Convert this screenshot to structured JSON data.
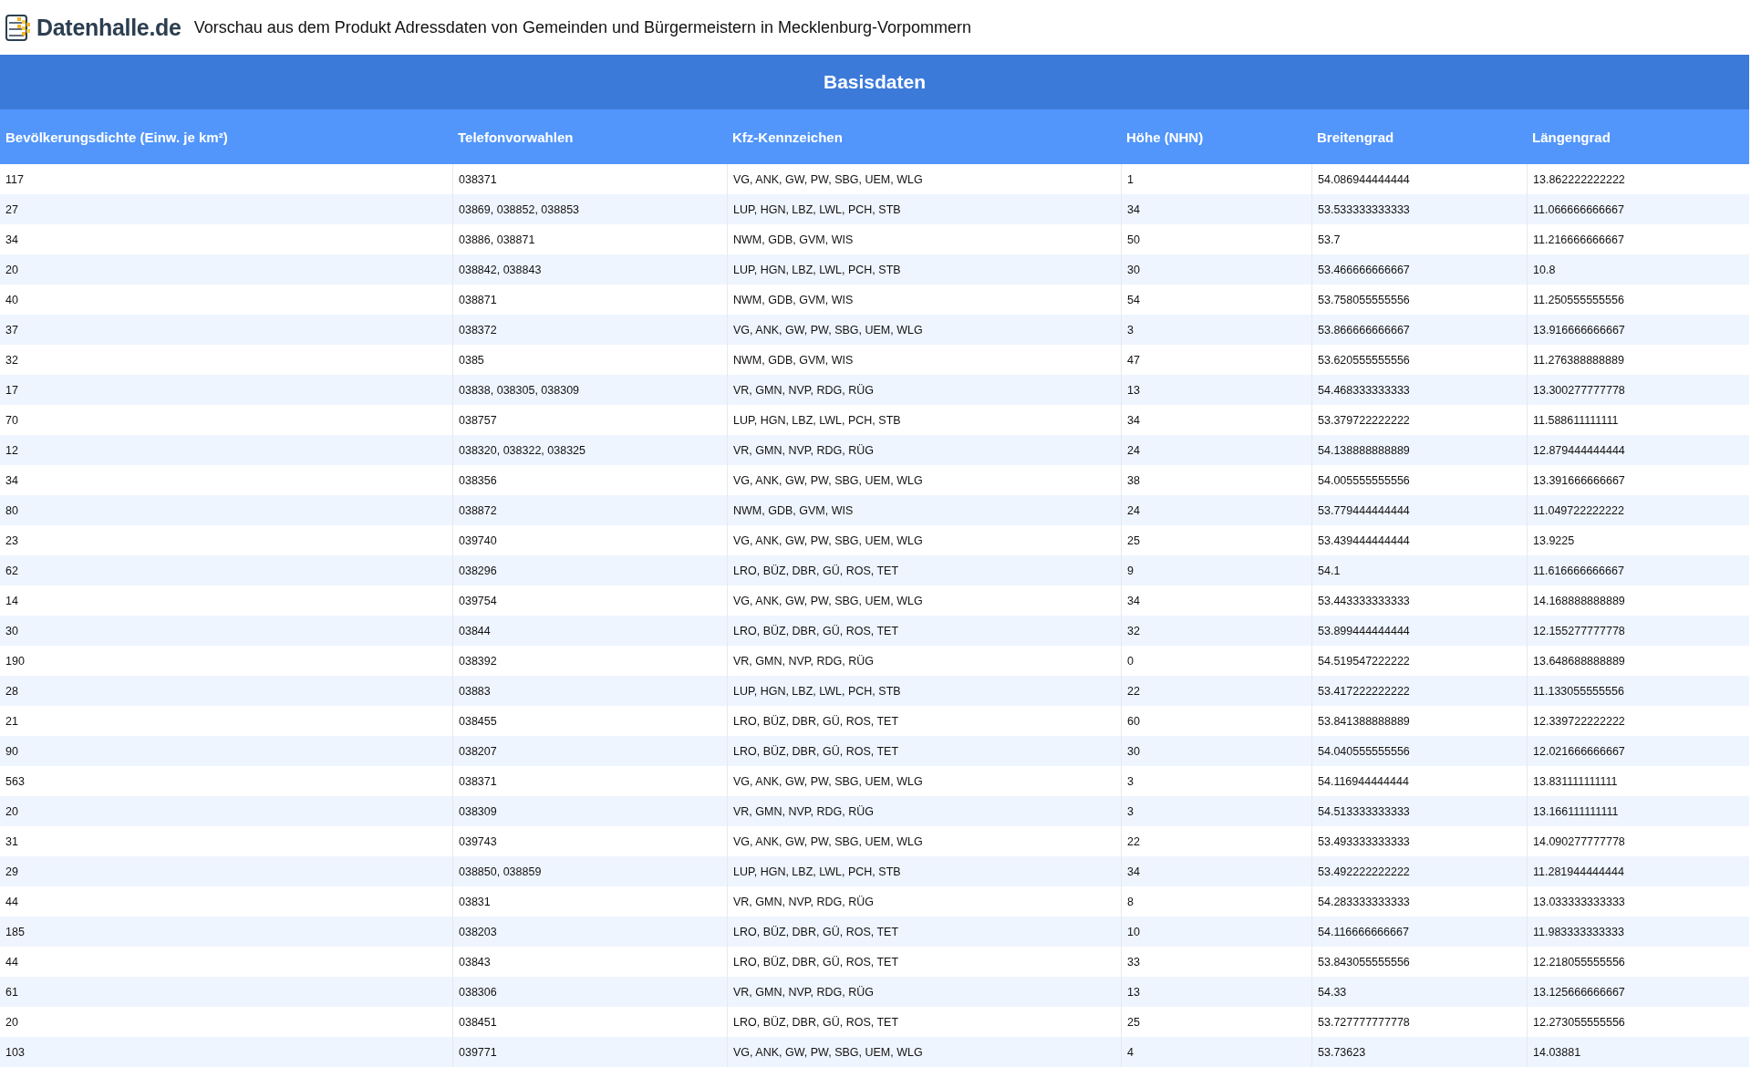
{
  "header": {
    "logo_text": "Datenhalle.de",
    "title": "Vorschau aus dem Produkt Adressdaten von Gemeinden und Bürgermeistern in Mecklenburg-Vorpommern"
  },
  "table": {
    "section_title": "Basisdaten",
    "columns": [
      "Bevölkerungsdichte (Einw. je km²)",
      "Telefonvorwahlen",
      "Kfz-Kennzeichen",
      "Höhe (NHN)",
      "Breitengrad",
      "Längengrad"
    ],
    "rows": [
      [
        "117",
        "038371",
        "VG, ANK, GW, PW, SBG, UEM, WLG",
        "1",
        "54.086944444444",
        "13.862222222222"
      ],
      [
        "27",
        "03869, 038852, 038853",
        "LUP, HGN, LBZ, LWL, PCH, STB",
        "34",
        "53.533333333333",
        "11.066666666667"
      ],
      [
        "34",
        "03886, 038871",
        "NWM, GDB, GVM, WIS",
        "50",
        "53.7",
        "11.216666666667"
      ],
      [
        "20",
        "038842, 038843",
        "LUP, HGN, LBZ, LWL, PCH, STB",
        "30",
        "53.466666666667",
        "10.8"
      ],
      [
        "40",
        "038871",
        "NWM, GDB, GVM, WIS",
        "54",
        "53.758055555556",
        "11.250555555556"
      ],
      [
        "37",
        "038372",
        "VG, ANK, GW, PW, SBG, UEM, WLG",
        "3",
        "53.866666666667",
        "13.916666666667"
      ],
      [
        "32",
        "0385",
        "NWM, GDB, GVM, WIS",
        "47",
        "53.620555555556",
        "11.276388888889"
      ],
      [
        "17",
        "03838, 038305, 038309",
        "VR, GMN, NVP, RDG, RÜG",
        "13",
        "54.468333333333",
        "13.300277777778"
      ],
      [
        "70",
        "038757",
        "LUP, HGN, LBZ, LWL, PCH, STB",
        "34",
        "53.379722222222",
        "11.588611111111"
      ],
      [
        "12",
        "038320, 038322, 038325",
        "VR, GMN, NVP, RDG, RÜG",
        "24",
        "54.138888888889",
        "12.879444444444"
      ],
      [
        "34",
        "038356",
        "VG, ANK, GW, PW, SBG, UEM, WLG",
        "38",
        "54.005555555556",
        "13.391666666667"
      ],
      [
        "80",
        "038872",
        "NWM, GDB, GVM, WIS",
        "24",
        "53.779444444444",
        "11.049722222222"
      ],
      [
        "23",
        "039740",
        "VG, ANK, GW, PW, SBG, UEM, WLG",
        "25",
        "53.439444444444",
        "13.9225"
      ],
      [
        "62",
        "038296",
        "LRO, BÜZ, DBR, GÜ, ROS, TET",
        "9",
        "54.1",
        "11.616666666667"
      ],
      [
        "14",
        "039754",
        "VG, ANK, GW, PW, SBG, UEM, WLG",
        "34",
        "53.443333333333",
        "14.168888888889"
      ],
      [
        "30",
        "03844",
        "LRO, BÜZ, DBR, GÜ, ROS, TET",
        "32",
        "53.899444444444",
        "12.155277777778"
      ],
      [
        "190",
        "038392",
        "VR, GMN, NVP, RDG, RÜG",
        "0",
        "54.519547222222",
        "13.648688888889"
      ],
      [
        "28",
        "03883",
        "LUP, HGN, LBZ, LWL, PCH, STB",
        "22",
        "53.417222222222",
        "11.133055555556"
      ],
      [
        "21",
        "038455",
        "LRO, BÜZ, DBR, GÜ, ROS, TET",
        "60",
        "53.841388888889",
        "12.339722222222"
      ],
      [
        "90",
        "038207",
        "LRO, BÜZ, DBR, GÜ, ROS, TET",
        "30",
        "54.040555555556",
        "12.021666666667"
      ],
      [
        "563",
        "038371",
        "VG, ANK, GW, PW, SBG, UEM, WLG",
        "3",
        "54.116944444444",
        "13.831111111111"
      ],
      [
        "20",
        "038309",
        "VR, GMN, NVP, RDG, RÜG",
        "3",
        "54.513333333333",
        "13.166111111111"
      ],
      [
        "31",
        "039743",
        "VG, ANK, GW, PW, SBG, UEM, WLG",
        "22",
        "53.493333333333",
        "14.090277777778"
      ],
      [
        "29",
        "038850, 038859",
        "LUP, HGN, LBZ, LWL, PCH, STB",
        "34",
        "53.492222222222",
        "11.281944444444"
      ],
      [
        "44",
        "03831",
        "VR, GMN, NVP, RDG, RÜG",
        "8",
        "54.283333333333",
        "13.033333333333"
      ],
      [
        "185",
        "038203",
        "LRO, BÜZ, DBR, GÜ, ROS, TET",
        "10",
        "54.116666666667",
        "11.983333333333"
      ],
      [
        "44",
        "03843",
        "LRO, BÜZ, DBR, GÜ, ROS, TET",
        "33",
        "53.843055555556",
        "12.218055555556"
      ],
      [
        "61",
        "038306",
        "VR, GMN, NVP, RDG, RÜG",
        "13",
        "54.33",
        "13.125666666667"
      ],
      [
        "20",
        "038451",
        "LRO, BÜZ, DBR, GÜ, ROS, TET",
        "25",
        "53.727777777778",
        "12.273055555556"
      ],
      [
        "103",
        "039771",
        "VG, ANK, GW, PW, SBG, UEM, WLG",
        "4",
        "53.73623",
        "14.03881"
      ]
    ]
  }
}
